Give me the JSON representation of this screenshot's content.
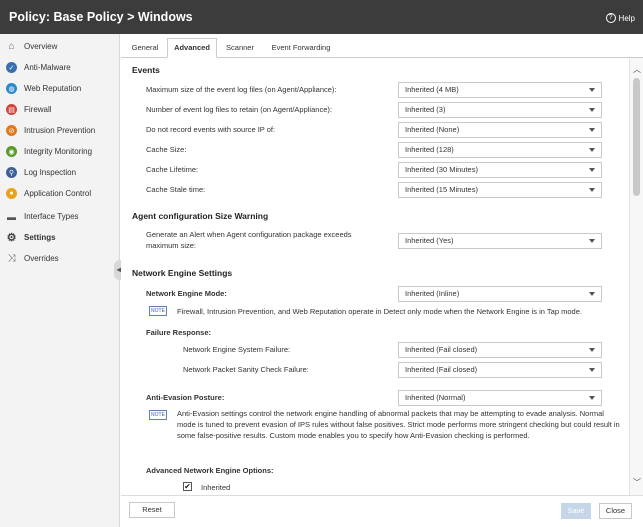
{
  "window": {
    "title": "Policy: Base Policy > Windows",
    "help_label": "Help",
    "help_symbol": "?"
  },
  "sidebar": {
    "items": [
      {
        "label": "Overview",
        "icon": "overview-icon",
        "color": "#666666",
        "glyph": "⌂"
      },
      {
        "label": "Anti-Malware",
        "icon": "anti-malware-icon",
        "color": "#3a6fb0",
        "glyph": "✓"
      },
      {
        "label": "Web Reputation",
        "icon": "web-reputation-icon",
        "color": "#2c8ac9",
        "glyph": "◍"
      },
      {
        "label": "Firewall",
        "icon": "firewall-icon",
        "color": "#d0453a",
        "glyph": "▤"
      },
      {
        "label": "Intrusion Prevention",
        "icon": "intrusion-prevention-icon",
        "color": "#e07a1f",
        "glyph": "⊘"
      },
      {
        "label": "Integrity Monitoring",
        "icon": "integrity-monitoring-icon",
        "color": "#5a9a2b",
        "glyph": "◉"
      },
      {
        "label": "Log Inspection",
        "icon": "log-inspection-icon",
        "color": "#3f5f9a",
        "glyph": "⚲"
      },
      {
        "label": "Application Control",
        "icon": "application-control-icon",
        "color": "#e8a21c",
        "glyph": "●"
      },
      {
        "label": "Interface Types",
        "icon": "interface-types-icon",
        "color": "#555555",
        "glyph": "▬"
      },
      {
        "label": "Settings",
        "icon": "settings-gear-icon",
        "color": "#444444",
        "glyph": "⚙"
      },
      {
        "label": "Overrides",
        "icon": "overrides-icon",
        "color": "#555555",
        "glyph": "⤨"
      }
    ],
    "active_index": 9,
    "collapse_symbol": "◀"
  },
  "tabs": [
    "General",
    "Advanced",
    "Scanner",
    "Event Forwarding"
  ],
  "active_tab": 1,
  "events": {
    "title": "Events",
    "rows": [
      {
        "label": "Maximum size of the event log files (on Agent/Appliance):",
        "value": "Inherited (4 MB)"
      },
      {
        "label": "Number of event log files to retain (on Agent/Appliance):",
        "value": "Inherited (3)"
      },
      {
        "label": "Do not record events with source IP of:",
        "value": "Inherited (None)"
      },
      {
        "label": "Cache Size:",
        "value": "Inherited (128)"
      },
      {
        "label": "Cache Lifetime:",
        "value": "Inherited (30 Minutes)"
      },
      {
        "label": "Cache Stale time:",
        "value": "Inherited (15 Minutes)"
      }
    ]
  },
  "agent_config": {
    "title": "Agent configuration Size Warning",
    "label": "Generate an Alert when Agent configuration package exceeds maximum size:",
    "value": "Inherited (Yes)"
  },
  "network_engine": {
    "title": "Network Engine Settings",
    "mode_label": "Network Engine Mode:",
    "mode_value": "Inherited (Inline)",
    "note_badge": "NOTE",
    "mode_note": "Firewall, Intrusion Prevention, and Web Reputation operate in Detect only mode when the Network Engine is in Tap mode.",
    "failure_title": "Failure Response:",
    "failure_rows": [
      {
        "label": "Network Engine System Failure:",
        "value": "Inherited (Fail closed)"
      },
      {
        "label": "Network Packet Sanity Check Failure:",
        "value": "Inherited (Fail closed)"
      }
    ],
    "evasion_label": "Anti-Evasion Posture:",
    "evasion_value": "Inherited (Normal)",
    "evasion_note": "Anti-Evasion settings control the network engine handling of abnormal packets that may be attempting to evade analysis. Normal mode is tuned to prevent evasion of IPS rules without false positives. Strict mode performs more stringent checking but could result in some false-positive results. Custom mode enables you to specify how Anti-Evasion checking is performed.",
    "advanced_title": "Advanced Network Engine Options:",
    "inherited_label": "Inherited",
    "inherited_checked": "✔"
  },
  "footer": {
    "reset": "Reset",
    "save": "Save",
    "close": "Close"
  }
}
